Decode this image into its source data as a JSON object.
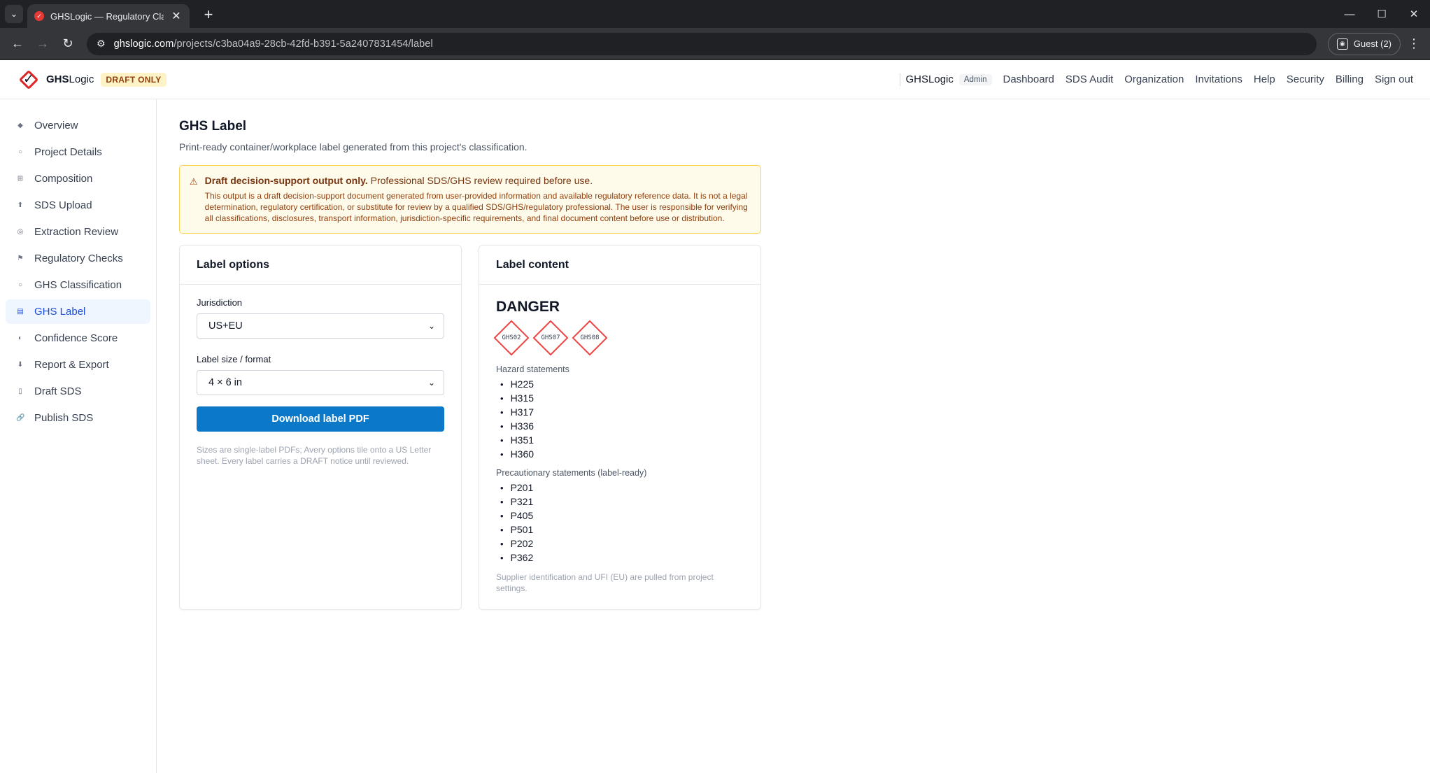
{
  "browser": {
    "tab_title": "GHSLogic — Regulatory Classi",
    "url_domain": "ghslogic.com",
    "url_path": "/projects/c3ba04a9-28cb-42fd-b391-5a2407831454/label",
    "profile_label": "Guest (2)"
  },
  "header": {
    "brand_bold": "GHS",
    "brand_rest": "Logic",
    "draft_badge": "DRAFT ONLY",
    "org_name": "GHSLogic",
    "role_badge": "Admin",
    "nav": [
      "Dashboard",
      "SDS Audit",
      "Organization",
      "Invitations",
      "Help",
      "Security",
      "Billing",
      "Sign out"
    ]
  },
  "sidebar": {
    "items": [
      {
        "label": "Overview",
        "icon": "◆"
      },
      {
        "label": "Project Details",
        "icon": "○"
      },
      {
        "label": "Composition",
        "icon": "⊞"
      },
      {
        "label": "SDS Upload",
        "icon": "⬆"
      },
      {
        "label": "Extraction Review",
        "icon": "◎"
      },
      {
        "label": "Regulatory Checks",
        "icon": "⚑"
      },
      {
        "label": "GHS Classification",
        "icon": "○"
      },
      {
        "label": "GHS Label",
        "icon": "▤"
      },
      {
        "label": "Confidence Score",
        "icon": "◐"
      },
      {
        "label": "Report & Export",
        "icon": "⬇"
      },
      {
        "label": "Draft SDS",
        "icon": "▯"
      },
      {
        "label": "Publish SDS",
        "icon": "🔗"
      }
    ],
    "active_index": 7
  },
  "main": {
    "title": "GHS Label",
    "subtitle": "Print-ready container/workplace label generated from this project's classification.",
    "warning": {
      "title_bold": "Draft decision-support output only.",
      "title_rest": " Professional SDS/GHS review required before use.",
      "body": "This output is a draft decision-support document generated from user-provided information and available regulatory reference data. It is not a legal determination, regulatory certification, or substitute for review by a qualified SDS/GHS/regulatory professional. The user is responsible for verifying all classifications, disclosures, transport information, jurisdiction-specific requirements, and final document content before use or distribution."
    },
    "options_card": {
      "title": "Label options",
      "jurisdiction_label": "Jurisdiction",
      "jurisdiction_value": "US+EU",
      "size_label": "Label size / format",
      "size_value": "4 × 6 in",
      "download_button": "Download label PDF",
      "hint": "Sizes are single-label PDFs; Avery options tile onto a US Letter sheet. Every label carries a DRAFT notice until reviewed."
    },
    "content_card": {
      "title": "Label content",
      "signal_word": "DANGER",
      "pictograms": [
        "GHS02",
        "GHS07",
        "GHS08"
      ],
      "hazard_label": "Hazard statements",
      "hazard_statements": [
        "H225",
        "H315",
        "H317",
        "H336",
        "H351",
        "H360"
      ],
      "precaution_label": "Precautionary statements (label-ready)",
      "precautionary_statements": [
        "P201",
        "P321",
        "P405",
        "P501",
        "P202",
        "P362"
      ],
      "footnote": "Supplier identification and UFI (EU) are pulled from project settings."
    }
  }
}
